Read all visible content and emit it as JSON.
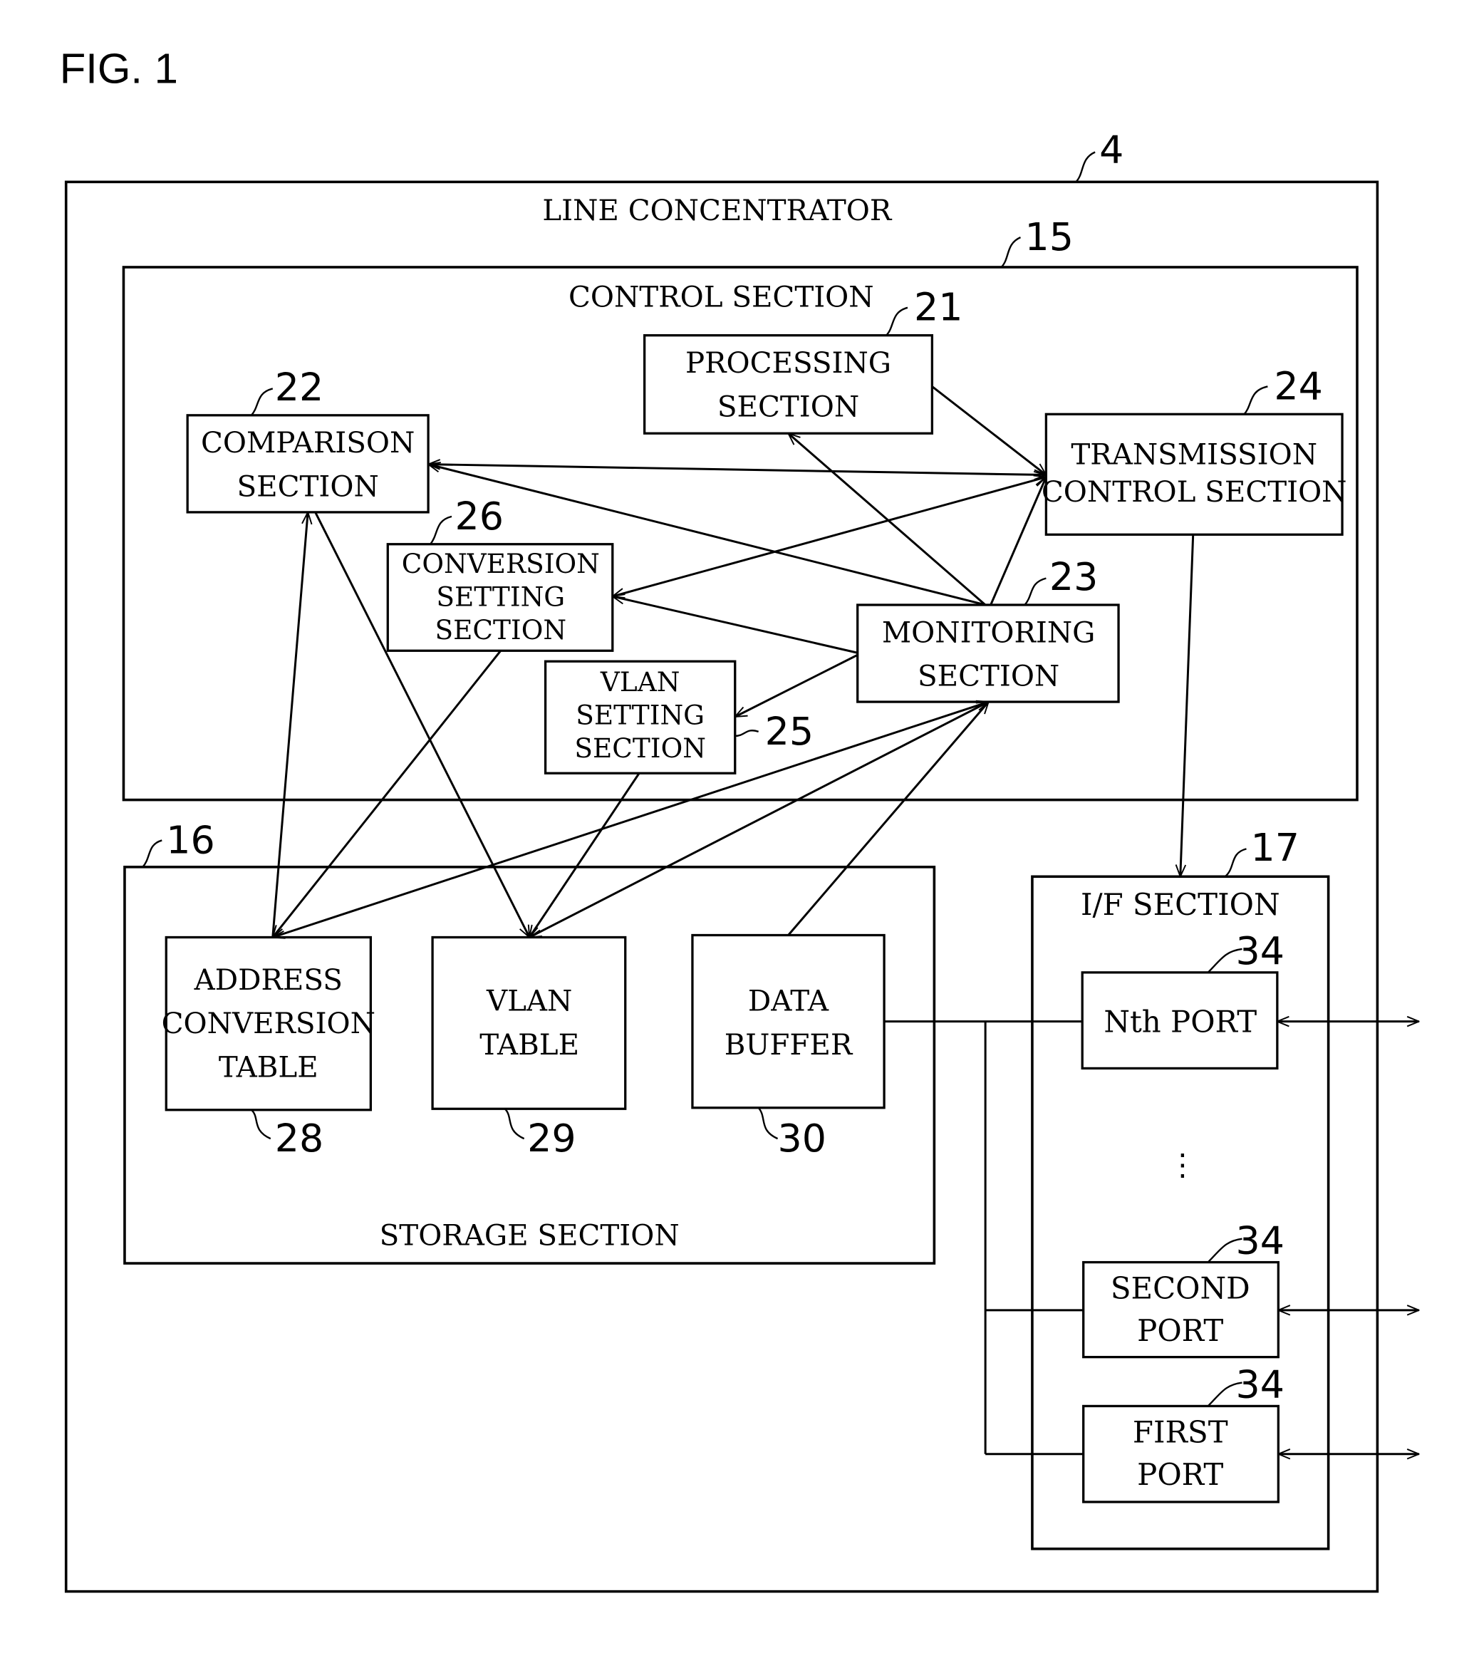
{
  "figure": {
    "title": "FIG. 1"
  },
  "line_concentrator": {
    "label": "LINE CONCENTRATOR",
    "ref": "4"
  },
  "control_section": {
    "label": "CONTROL SECTION",
    "ref": "15",
    "blocks": {
      "processing": {
        "lines": [
          "PROCESSING",
          "SECTION"
        ],
        "ref": "21"
      },
      "comparison": {
        "lines": [
          "COMPARISON",
          "SECTION"
        ],
        "ref": "22"
      },
      "monitoring": {
        "lines": [
          "MONITORING",
          "SECTION"
        ],
        "ref": "23"
      },
      "transmission": {
        "lines": [
          "TRANSMISSION",
          "CONTROL SECTION"
        ],
        "ref": "24"
      },
      "vlan_setting": {
        "lines": [
          "VLAN",
          "SETTING",
          "SECTION"
        ],
        "ref": "25"
      },
      "conversion_setting": {
        "lines": [
          "CONVERSION",
          "SETTING",
          "SECTION"
        ],
        "ref": "26"
      }
    }
  },
  "storage_section": {
    "label": "STORAGE SECTION",
    "ref": "16",
    "blocks": {
      "address_table": {
        "lines": [
          "ADDRESS",
          "CONVERSION",
          "TABLE"
        ],
        "ref": "28"
      },
      "vlan_table": {
        "lines": [
          "VLAN",
          "TABLE"
        ],
        "ref": "29"
      },
      "data_buffer": {
        "lines": [
          "DATA",
          "BUFFER"
        ],
        "ref": "30"
      }
    }
  },
  "if_section": {
    "label": "I/F SECTION",
    "ref": "17",
    "ellipsis": "⋮",
    "ports": [
      {
        "lines": [
          "Nth PORT"
        ],
        "ref": "34"
      },
      {
        "lines": [
          "SECOND",
          "PORT"
        ],
        "ref": "34"
      },
      {
        "lines": [
          "FIRST",
          "PORT"
        ],
        "ref": "34"
      }
    ]
  }
}
